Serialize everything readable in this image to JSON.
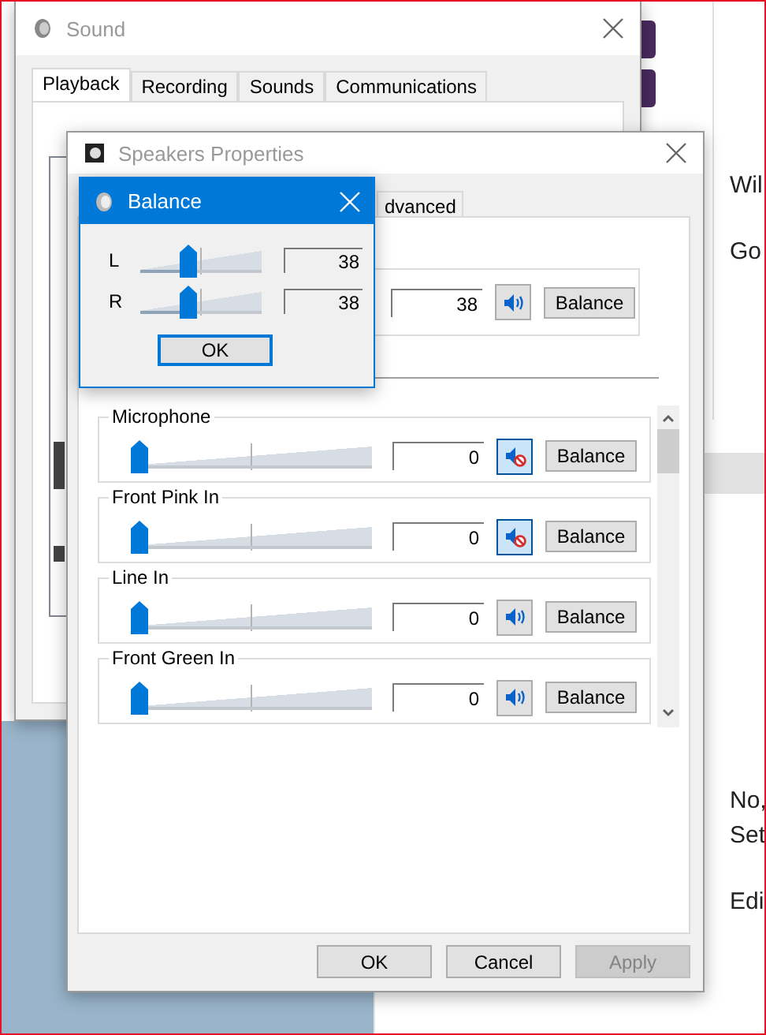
{
  "sound_window": {
    "title": "Sound",
    "tabs": [
      {
        "label": "Playback",
        "selected": true
      },
      {
        "label": "Recording",
        "selected": false
      },
      {
        "label": "Sounds",
        "selected": false
      },
      {
        "label": "Communications",
        "selected": false
      }
    ]
  },
  "speakers_window": {
    "title": "Speakers Properties",
    "tabs": [
      {
        "label": "dvanced",
        "selected": false
      }
    ],
    "master": {
      "value": "38",
      "muted": false,
      "button": "Balance"
    },
    "channels": [
      {
        "name": "Microphone",
        "level": 0,
        "value": "0",
        "muted": true,
        "button": "Balance"
      },
      {
        "name": "Front Pink In",
        "level": 0,
        "value": "0",
        "muted": true,
        "button": "Balance"
      },
      {
        "name": "Line In",
        "level": 0,
        "value": "0",
        "muted": false,
        "button": "Balance"
      },
      {
        "name": "Front Green In",
        "level": 0,
        "value": "0",
        "muted": false,
        "button": "Balance"
      }
    ],
    "buttons": [
      {
        "label": "OK",
        "disabled": false
      },
      {
        "label": "Cancel",
        "disabled": false
      },
      {
        "label": "Apply",
        "disabled": true
      }
    ]
  },
  "balance_dialog": {
    "title": "Balance",
    "channels": [
      {
        "label": "L",
        "level": 0.38,
        "value": "38"
      },
      {
        "label": "R",
        "level": 0.38,
        "value": "38"
      }
    ],
    "button": "OK"
  },
  "background_page": {
    "lines": [
      "Wil",
      "Go",
      "No,",
      "Set",
      "Edi"
    ]
  }
}
